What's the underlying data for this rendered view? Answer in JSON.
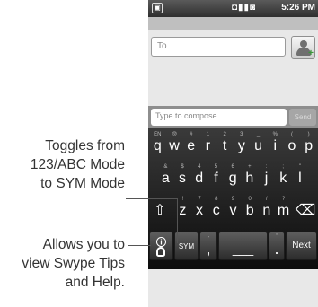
{
  "status_bar": {
    "left_icon": "▣",
    "right_icons": "◘▮▮◙",
    "time": "5:26 PM"
  },
  "compose": {
    "to_placeholder": "To",
    "message_placeholder": "Type to compose",
    "send_label": "Send"
  },
  "keyboard": {
    "row1": [
      {
        "key": "q",
        "alt": "EN"
      },
      {
        "key": "w",
        "alt": "@"
      },
      {
        "key": "e",
        "alt": "#"
      },
      {
        "key": "r",
        "alt": "1"
      },
      {
        "key": "t",
        "alt": "2"
      },
      {
        "key": "y",
        "alt": "3"
      },
      {
        "key": "u",
        "alt": "_"
      },
      {
        "key": "i",
        "alt": "%"
      },
      {
        "key": "o",
        "alt": "("
      },
      {
        "key": "p",
        "alt": ")"
      }
    ],
    "row2": [
      {
        "key": "a",
        "alt": "&"
      },
      {
        "key": "s",
        "alt": "$"
      },
      {
        "key": "d",
        "alt": "4"
      },
      {
        "key": "f",
        "alt": "5"
      },
      {
        "key": "g",
        "alt": "6"
      },
      {
        "key": "h",
        "alt": "+"
      },
      {
        "key": "j",
        "alt": ":"
      },
      {
        "key": "k",
        "alt": ";"
      },
      {
        "key": "l",
        "alt": "\""
      }
    ],
    "row3": [
      {
        "key": "z",
        "alt": "!"
      },
      {
        "key": "x",
        "alt": "7"
      },
      {
        "key": "c",
        "alt": "8"
      },
      {
        "key": "v",
        "alt": "9"
      },
      {
        "key": "b",
        "alt": "0"
      },
      {
        "key": "n",
        "alt": "/"
      },
      {
        "key": "m",
        "alt": "?"
      }
    ],
    "shift_icon": "⇧",
    "delete_icon": "⌫",
    "tips_icon": "🛈",
    "sym_label": "SYM",
    "comma_label": ",",
    "comma_alt": "-",
    "space_label": "___",
    "period_label": ".",
    "period_alt": "'",
    "next_label": "Next"
  },
  "callouts": {
    "toggle_text": [
      "Toggles from",
      "123/ABC Mode",
      "to SYM Mode"
    ],
    "tips_text": [
      "Allows you to",
      "view Swype Tips",
      "and Help."
    ]
  }
}
